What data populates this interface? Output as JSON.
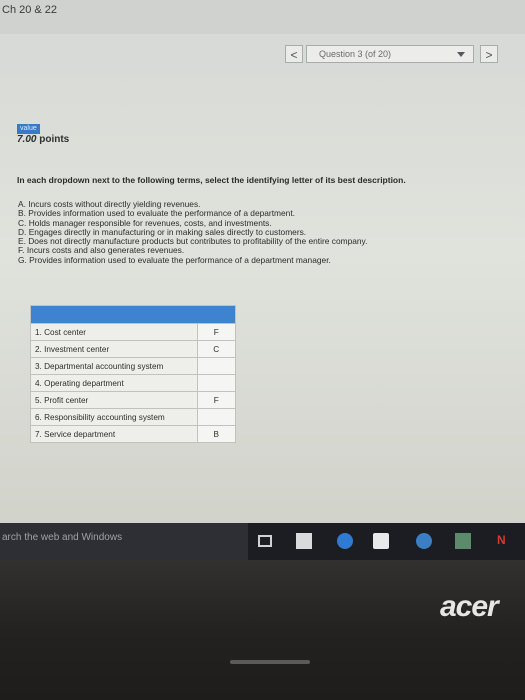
{
  "browser": {
    "tab_title": "Ch 20 & 22"
  },
  "nav": {
    "prev_label": "<",
    "next_label": ">",
    "question_select": "Question 3 (of 20)"
  },
  "question": {
    "value_label": "value",
    "points": "7.00",
    "points_unit": "points",
    "instructions": "In each dropdown next to the following terms, select the identifying letter of its best description.",
    "options": [
      "A. Incurs costs without directly yielding revenues.",
      "B. Provides information used to evaluate the performance of a department.",
      "C. Holds manager responsible for revenues, costs, and investments.",
      "D. Engages directly in manufacturing or in making sales directly to customers.",
      "E. Does not directly manufacture products but contributes to profitability of the entire company.",
      "F. Incurs costs and also generates revenues.",
      "G. Provides information used to evaluate the performance of a department manager."
    ]
  },
  "match_table": {
    "rows": [
      {
        "term": "1. Cost center",
        "answer": "F"
      },
      {
        "term": "2. Investment center",
        "answer": "C"
      },
      {
        "term": "3. Departmental accounting system",
        "answer": ""
      },
      {
        "term": "4. Operating department",
        "answer": ""
      },
      {
        "term": "5. Profit center",
        "answer": "F"
      },
      {
        "term": "6. Responsibility accounting system",
        "answer": ""
      },
      {
        "term": "7. Service department",
        "answer": "B"
      }
    ]
  },
  "taskbar": {
    "search_placeholder": "arch the web and Windows",
    "icons": [
      "task-view-icon",
      "file-explorer-icon",
      "edge-icon",
      "store-icon",
      "internet-explorer-icon",
      "app-icon",
      "app-n-icon"
    ],
    "app_n_label": "N"
  },
  "device": {
    "brand": "acer"
  },
  "colors": {
    "accent": "#3f83d0",
    "value_badge": "#3b79c7"
  }
}
